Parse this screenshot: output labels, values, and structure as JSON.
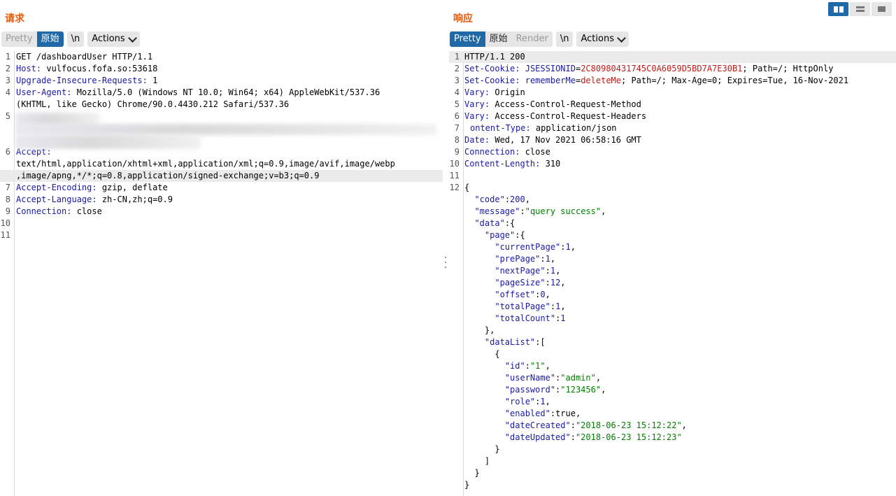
{
  "request": {
    "title": "请求",
    "view_tabs": [
      "Pretty",
      "原始"
    ],
    "active_tab": "原始",
    "newline_label": "\\n",
    "actions_label": "Actions",
    "line_numbers": [
      "1",
      "2",
      "3",
      "4",
      "",
      "5",
      "",
      "",
      "6",
      "",
      "",
      "7",
      "8",
      "9",
      "10",
      "11"
    ],
    "lines": [
      {
        "head": "GET /dashboardUser HTTP/1.1",
        "value": ""
      },
      {
        "head": "Host:",
        "value": " vulfocus.fofa.so:53618"
      },
      {
        "head": "Upgrade-Insecure-Requests:",
        "value": " 1"
      },
      {
        "head": "User-Agent:",
        "value": " Mozilla/5.0 (Windows NT 10.0; Win64; x64) AppleWebKit/537.36"
      },
      {
        "head": "",
        "value": "(KHTML, like Gecko) Chrome/90.0.4430.212 Safari/537.36"
      },
      {
        "head": "",
        "value": ""
      },
      {
        "head": "",
        "value": ""
      },
      {
        "head": "",
        "value": ""
      },
      {
        "head": "Accept:",
        "value": ""
      },
      {
        "head": "",
        "value": "text/html,application/xhtml+xml,application/xml;q=0.9,image/avif,image/webp"
      },
      {
        "head": "",
        "value": ",image/apng,*/*;q=0.8,application/signed-exchange;v=b3;q=0.9"
      },
      {
        "head": "Accept-Encoding:",
        "value": " gzip, deflate"
      },
      {
        "head": "Accept-Language:",
        "value": " zh-CN,zh;q=0.9"
      },
      {
        "head": "Connection:",
        "value": " close"
      },
      {
        "head": "",
        "value": ""
      },
      {
        "head": "",
        "value": ""
      }
    ]
  },
  "response": {
    "title": "响应",
    "view_tabs": [
      "Pretty",
      "原始",
      "Render"
    ],
    "active_tab": "Pretty",
    "newline_label": "\\n",
    "actions_label": "Actions",
    "headers": {
      "status": "HTTP/1.1 200",
      "set_cookie_1_name": "JSESSIONID",
      "set_cookie_1_value": "2C80980431745C0A6059D5BD7A7E30B1",
      "set_cookie_1_rest": "; Path=/; HttpOnly",
      "set_cookie_2_name": "rememberMe",
      "set_cookie_2_value": "deleteMe",
      "set_cookie_2_rest": "; Path=/; Max-Age=0; Expires=Tue, 16-Nov-2021",
      "vary_1": " Origin",
      "vary_2": " Access-Control-Request-Method",
      "vary_3": " Access-Control-Request-Headers",
      "content_type": " application/json",
      "date": " Wed, 17 Nov 2021 06:58:16 GMT",
      "connection": " close",
      "content_length": " 310",
      "content_type_label": "ontent-Type:"
    },
    "body": {
      "code": "200",
      "message": "\"query success\"",
      "page": {
        "currentPage": "1",
        "prePage": "1",
        "nextPage": "1",
        "pageSize": "12",
        "offset": "0",
        "totalPage": "1",
        "totalCount": "1"
      },
      "item": {
        "id": "\"1\"",
        "userName": "\"admin\"",
        "password": "\"123456\"",
        "role": "1",
        "enabled": "true",
        "dateCreated": "\"2018-06-23 15:12:22\"",
        "dateUpdated": "\"2018-06-23 15:12:23\""
      }
    }
  },
  "text": {
    "set_cookie": "Set-Cookie:",
    "vary": "Vary:",
    "date": "Date:",
    "connection": "Connection:",
    "content_length": "Content-Length:",
    "k_code": "\"code\"",
    "k_message": "\"message\"",
    "k_data": "\"data\"",
    "k_page": "\"page\"",
    "k_currentPage": "\"currentPage\"",
    "k_prePage": "\"prePage\"",
    "k_nextPage": "\"nextPage\"",
    "k_pageSize": "\"pageSize\"",
    "k_offset": "\"offset\"",
    "k_totalPage": "\"totalPage\"",
    "k_totalCount": "\"totalCount\"",
    "k_dataList": "\"dataList\"",
    "k_id": "\"id\"",
    "k_userName": "\"userName\"",
    "k_password": "\"password\"",
    "k_role": "\"role\"",
    "k_enabled": "\"enabled\"",
    "k_dateCreated": "\"dateCreated\"",
    "k_dateUpdated": "\"dateUpdated\""
  },
  "layout_buttons": [
    {
      "icon": "split-columns-icon",
      "active": true
    },
    {
      "icon": "split-rows-icon",
      "active": false
    },
    {
      "icon": "single-pane-icon",
      "active": false
    }
  ],
  "colors": {
    "title": "#e8590c",
    "active_tab": "#1f69a8",
    "header_name": "#1a1aa6",
    "cookie_value": "#c41a16",
    "json_string": "#008000"
  }
}
